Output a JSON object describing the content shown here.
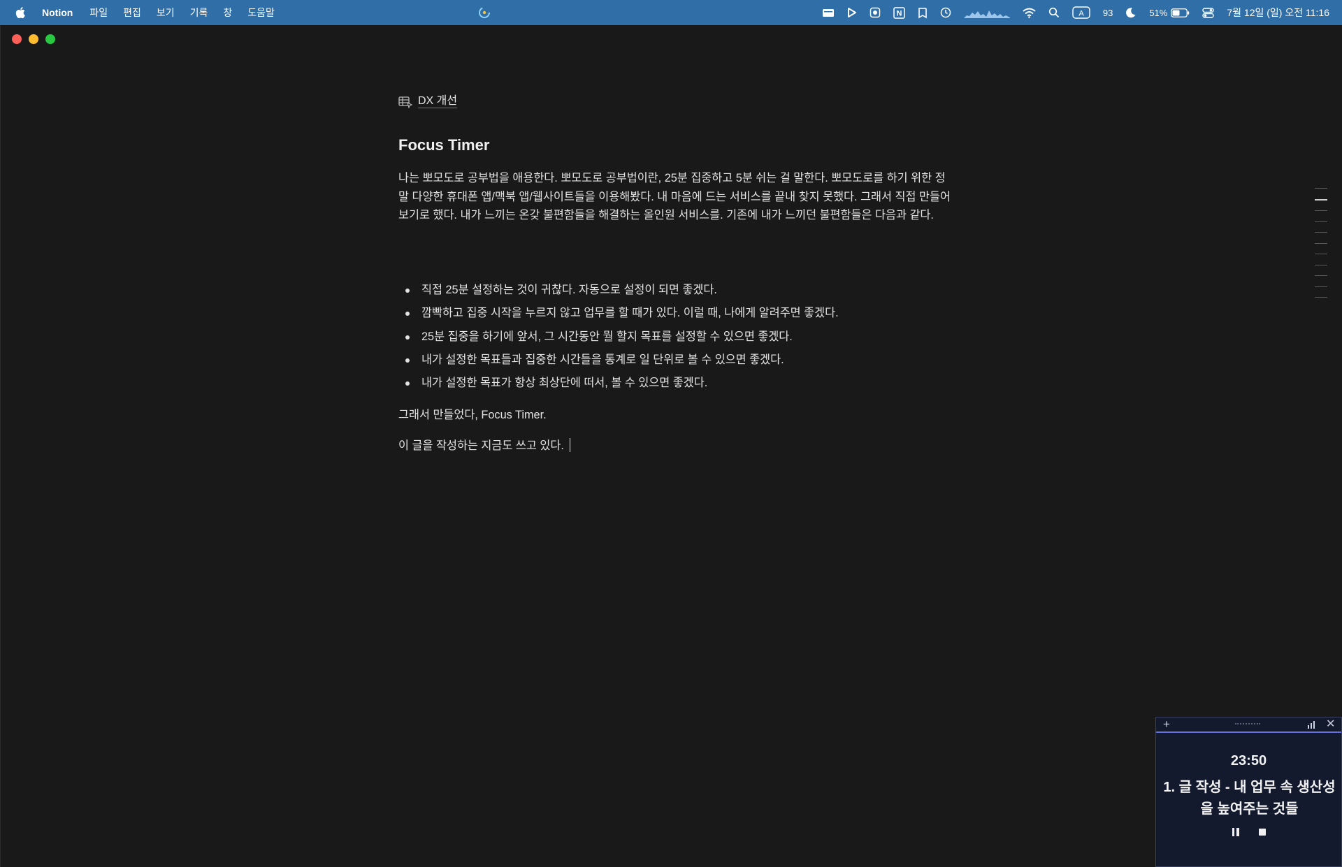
{
  "menubar": {
    "app_name": "Notion",
    "menus": [
      "파일",
      "편집",
      "보기",
      "기록",
      "창",
      "도움말"
    ],
    "battery_percent": "51%",
    "number_badge": "93",
    "input_indicator": "A",
    "datetime": "7월 12일 (일) 오전 11:16"
  },
  "page": {
    "breadcrumb": "DX 개선",
    "title": "Focus Timer",
    "intro": "나는 뽀모도로 공부법을 애용한다. 뽀모도로 공부법이란, 25분 집중하고 5분 쉬는 걸 말한다. 뽀모도로를 하기 위한 정말 다양한 휴대폰 앱/맥북 앱/웹사이트들을 이용해봤다. 내 마음에 드는 서비스를 끝내 찾지 못했다. 그래서 직접 만들어보기로 했다. 내가 느끼는 온갖 불편함들을 해결하는 올인원 서비스를. 기존에 내가 느끼던 불편함들은 다음과 같다.",
    "bullets": [
      "직접 25분 설정하는 것이 귀찮다. 자동으로 설정이 되면 좋겠다.",
      "깜빡하고 집중 시작을 누르지 않고 업무를 할 때가 있다. 이럴 때, 나에게 알려주면 좋겠다.",
      "25분 집중을 하기에 앞서, 그 시간동안 뭘 할지 목표를 설정할 수 있으면 좋겠다.",
      "내가 설정한 목표들과 집중한 시간들을 통계로 일 단위로 볼 수 있으면 좋겠다.",
      "내가 설정한 목표가 항상 최상단에 떠서, 볼 수 있으면 좋겠다."
    ],
    "closing": "그래서 만들었다, Focus Timer.",
    "last_line": "이 글을 작성하는 지금도 쓰고 있다."
  },
  "timer_widget": {
    "time": "23:50",
    "goal": "1. 글 작성 - 내 업무 속 생산성을 높여주는 것들"
  },
  "colors": {
    "menubar": "#2f6ea6",
    "background": "#191919",
    "timer_bg": "#131a2e",
    "timer_accent": "#6472d8"
  }
}
